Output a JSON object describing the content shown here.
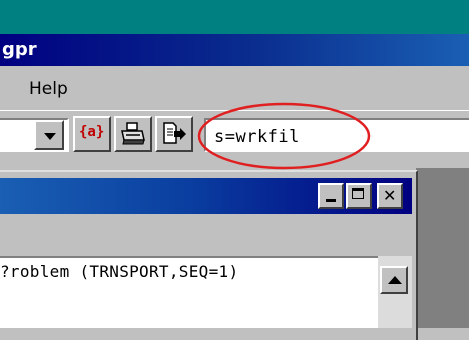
{
  "app": {
    "title": "gpr"
  },
  "menu": {
    "help_label": "Help"
  },
  "toolbar": {
    "combo_value": "",
    "icons": [
      "chevron-down-icon",
      "variable-a-icon",
      "printer-icon",
      "export-icon"
    ],
    "command_value": "s=wrkfil"
  },
  "child_window": {
    "title": "",
    "controls": [
      "minimize-icon",
      "maximize-icon",
      "close-icon"
    ],
    "content_line": "?roblem (TRNSPORT,SEQ=1)"
  },
  "colors": {
    "desktop": "#008080",
    "titlebar": "#000080",
    "annotation_circle": "#e02020"
  }
}
